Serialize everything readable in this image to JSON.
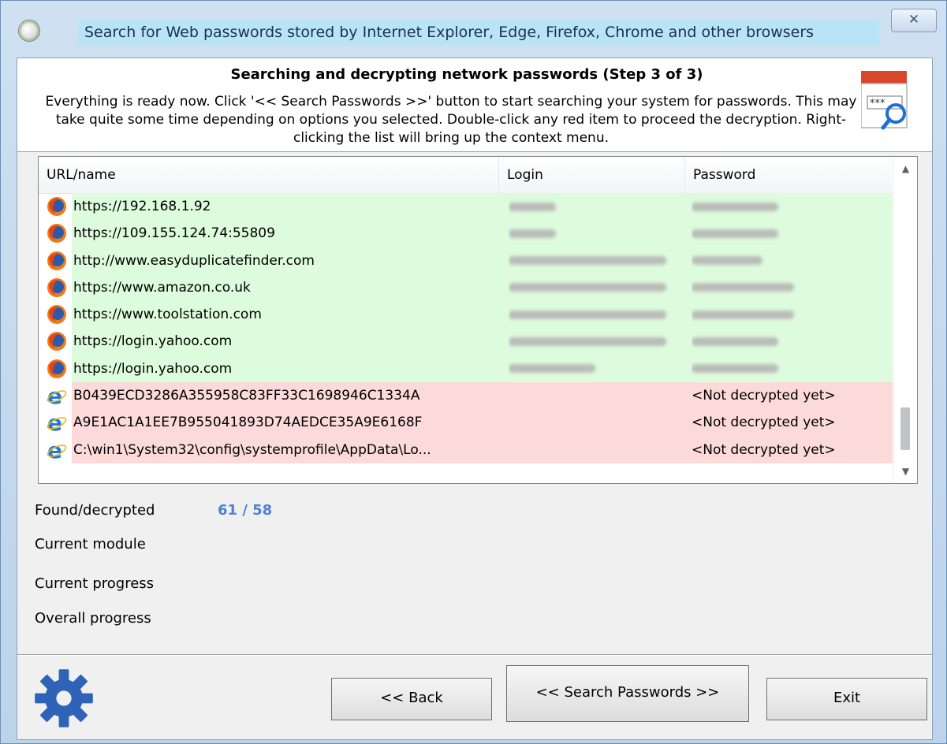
{
  "window": {
    "title": "Search for Web passwords stored by Internet Explorer, Edge, Firefox, Chrome and other browsers",
    "close_glyph": "✕"
  },
  "header": {
    "title": "Searching and decrypting network passwords (Step 3 of 3)",
    "description": "Everything is ready now. Click '<< Search Passwords >>' button to start searching your system for passwords. This may take quite some time depending on options you selected. Double-click any red item to proceed the decryption. Right-clicking the list will bring up the context menu.",
    "graphic_text": "***"
  },
  "list": {
    "columns": [
      "URL/name",
      "Login",
      "Password"
    ],
    "rows": [
      {
        "browser": "firefox-icon",
        "status": "decrypted",
        "url": "https://192.168.1.92",
        "login": "",
        "password": ""
      },
      {
        "browser": "firefox-icon",
        "status": "decrypted",
        "url": "https://109.155.124.74:55809",
        "login": "",
        "password": ""
      },
      {
        "browser": "firefox-icon",
        "status": "decrypted",
        "url": "http://www.easyduplicatefinder.com",
        "login": "",
        "password": ""
      },
      {
        "browser": "firefox-icon",
        "status": "decrypted",
        "url": "https://www.amazon.co.uk",
        "login": "",
        "password": ""
      },
      {
        "browser": "firefox-icon",
        "status": "decrypted",
        "url": "https://www.toolstation.com",
        "login": "",
        "password": ""
      },
      {
        "browser": "firefox-icon",
        "status": "decrypted",
        "url": "https://login.yahoo.com",
        "login": "",
        "password": ""
      },
      {
        "browser": "firefox-icon",
        "status": "decrypted",
        "url": "https://login.yahoo.com",
        "login": "",
        "password": ""
      },
      {
        "browser": "ie-icon",
        "status": "encrypted",
        "url": "B0439ECD3286A355958C83FF33C1698946C1334A",
        "login": "",
        "password": "<Not decrypted yet>"
      },
      {
        "browser": "ie-icon",
        "status": "encrypted",
        "url": "A9E1AC1A1EE7B955041893D74AEDCE35A9E6168F",
        "login": "",
        "password": "<Not decrypted yet>"
      },
      {
        "browser": "ie-icon",
        "status": "encrypted",
        "url": "C:\\win1\\System32\\config\\systemprofile\\AppData\\Lo...",
        "login": "",
        "password": "<Not decrypted yet>"
      }
    ],
    "colors": {
      "decrypted_row": "#ddfbdd",
      "encrypted_row": "#fcdada"
    }
  },
  "status": {
    "found_label": "Found/decrypted",
    "found_value": "61 / 58",
    "module_label": "Current module",
    "current_progress_label": "Current progress",
    "overall_progress_label": "Overall progress",
    "value_color": "#4d82d6"
  },
  "buttons": {
    "back": "<< Back",
    "search": "<< Search Passwords >>",
    "exit": "Exit"
  }
}
